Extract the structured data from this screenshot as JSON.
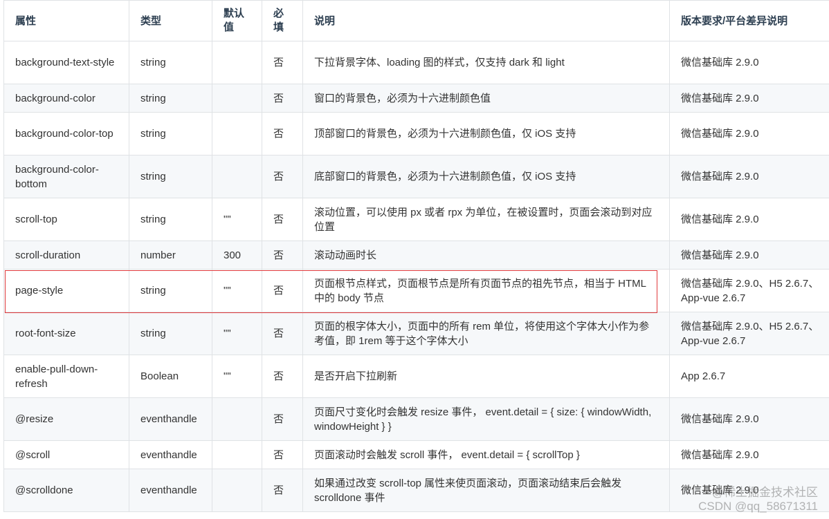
{
  "headers": {
    "attr": "属性",
    "type": "类型",
    "default": "默认值",
    "required": "必填",
    "desc": "说明",
    "version": "版本要求/平台差异说明"
  },
  "rows": [
    {
      "attr": "background-text-style",
      "type": "string",
      "default": "",
      "required": "否",
      "desc": "下拉背景字体、loading 图的样式，仅支持 dark 和 light",
      "version": "微信基础库 2.9.0"
    },
    {
      "attr": "background-color",
      "type": "string",
      "default": "",
      "required": "否",
      "desc": "窗口的背景色，必须为十六进制颜色值",
      "version": "微信基础库 2.9.0"
    },
    {
      "attr": "background-color-top",
      "type": "string",
      "default": "",
      "required": "否",
      "desc": "顶部窗口的背景色，必须为十六进制颜色值，仅 iOS 支持",
      "version": "微信基础库 2.9.0"
    },
    {
      "attr": "background-color-bottom",
      "type": "string",
      "default": "",
      "required": "否",
      "desc": "底部窗口的背景色，必须为十六进制颜色值，仅 iOS 支持",
      "version": "微信基础库 2.9.0"
    },
    {
      "attr": "scroll-top",
      "type": "string",
      "default": "\"\"",
      "required": "否",
      "desc": "滚动位置，可以使用 px 或者 rpx 为单位，在被设置时，页面会滚动到对应位置",
      "version": "微信基础库 2.9.0"
    },
    {
      "attr": "scroll-duration",
      "type": "number",
      "default": "300",
      "required": "否",
      "desc": "滚动动画时长",
      "version": "微信基础库 2.9.0"
    },
    {
      "attr": "page-style",
      "type": "string",
      "default": "\"\"",
      "required": "否",
      "desc": "页面根节点样式，页面根节点是所有页面节点的祖先节点，相当于 HTML 中的 body 节点",
      "version": "微信基础库 2.9.0、H5 2.6.7、App-vue 2.6.7"
    },
    {
      "attr": "root-font-size",
      "type": "string",
      "default": "\"\"",
      "required": "否",
      "desc": "页面的根字体大小，页面中的所有 rem 单位，将使用这个字体大小作为参考值，即 1rem 等于这个字体大小",
      "version": "微信基础库 2.9.0、H5 2.6.7、App-vue 2.6.7"
    },
    {
      "attr": "enable-pull-down-refresh",
      "type": "Boolean",
      "default": "\"\"",
      "required": "否",
      "desc": "是否开启下拉刷新",
      "version": "App 2.6.7"
    },
    {
      "attr": "@resize",
      "type": "eventhandle",
      "default": "",
      "required": "否",
      "desc": "页面尺寸变化时会触发 resize 事件， event.detail = { size: { windowWidth, windowHeight } }",
      "version": "微信基础库 2.9.0"
    },
    {
      "attr": "@scroll",
      "type": "eventhandle",
      "default": "",
      "required": "否",
      "desc": "页面滚动时会触发 scroll 事件， event.detail = { scrollTop }",
      "version": "微信基础库 2.9.0"
    },
    {
      "attr": "@scrolldone",
      "type": "eventhandle",
      "default": "",
      "required": "否",
      "desc": "如果通过改变 scroll-top 属性来使页面滚动，页面滚动结束后会触发 scrolldone 事件",
      "version": "微信基础库 2.9.0"
    }
  ],
  "watermark": {
    "line1": "@稀土掘金技术社区",
    "line2": "CSDN @qq_58671311"
  },
  "colors": {
    "highlight_border": "#e0393b",
    "stripe": "#f6f8fa",
    "border": "#dfe2e5"
  }
}
